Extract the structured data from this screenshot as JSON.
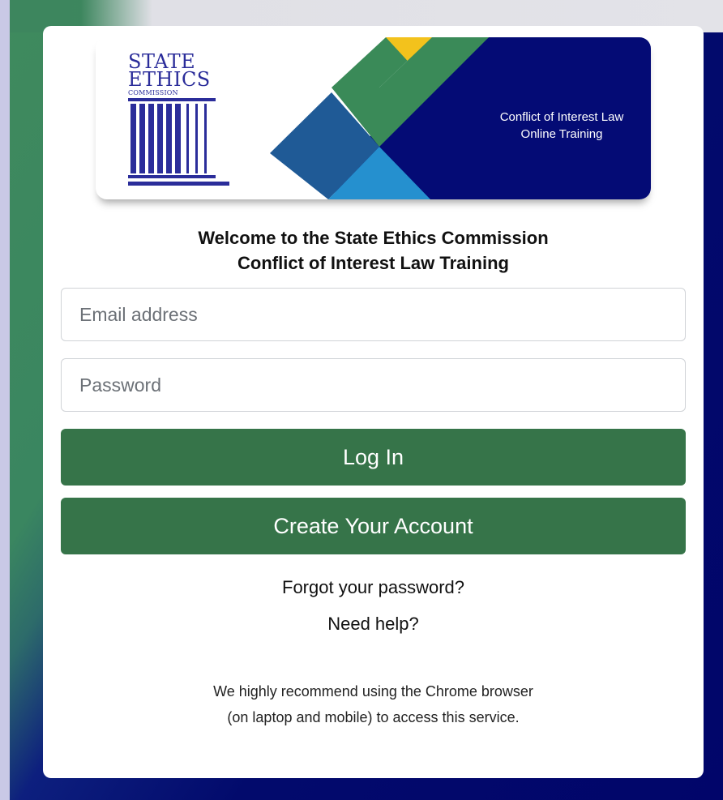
{
  "banner": {
    "logo_line1": "State",
    "logo_line2": "Ethics",
    "logo_line3": "Commission",
    "caption_line1": "Conflict of Interest Law",
    "caption_line2": "Online Training"
  },
  "welcome": {
    "line1": "Welcome to the State Ethics Commission",
    "line2": "Conflict of Interest Law Training"
  },
  "form": {
    "email_placeholder": "Email address",
    "email_value": "",
    "password_placeholder": "Password",
    "password_value": "",
    "login_label": "Log In",
    "create_label": "Create Your Account"
  },
  "links": {
    "forgot": "Forgot your password?",
    "help": "Need help?"
  },
  "notice": {
    "line1": "We highly recommend using the Chrome browser",
    "line2": "(on laptop and mobile) to access this service."
  },
  "colors": {
    "button": "#367449",
    "navy": "#040b75",
    "accent_green": "#3a8a58",
    "accent_yellow": "#f3c21c",
    "accent_blue": "#1f5a96",
    "accent_light_blue": "#2590cf",
    "logo_blue": "#2b2d9a"
  }
}
